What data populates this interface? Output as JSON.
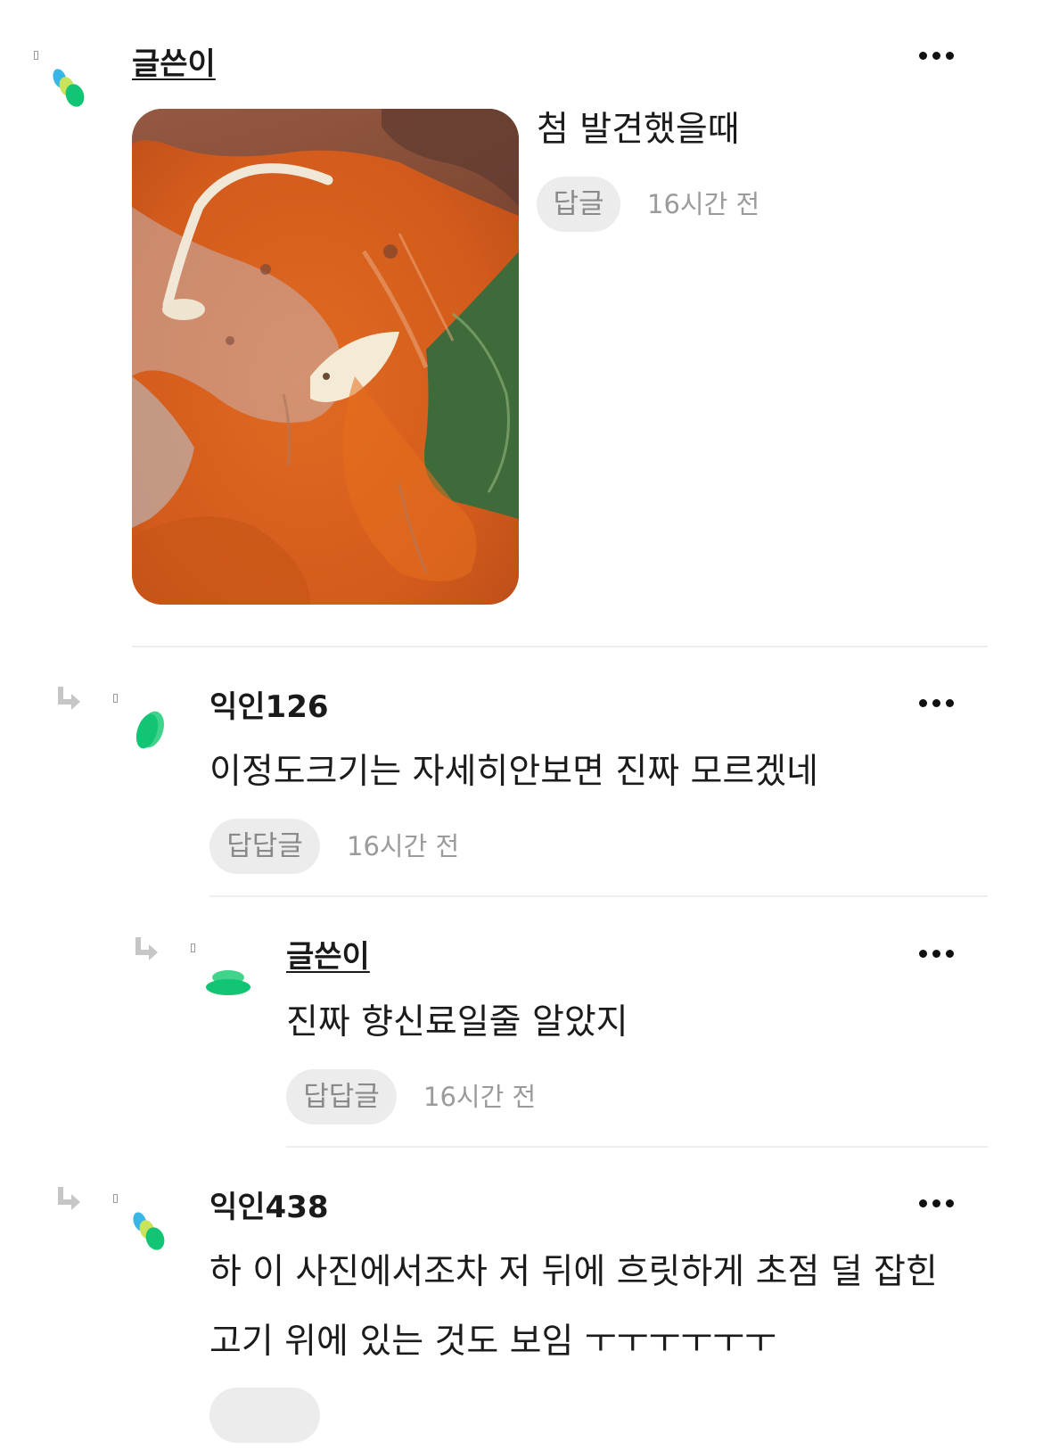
{
  "comments": [
    {
      "name": "글쓴이",
      "is_author": true,
      "text": "첨 발견했을때",
      "reply_label": "답글",
      "time": "16시간 전",
      "avatar": "leaf-cluster-multicolor"
    },
    {
      "name": "익인126",
      "is_author": false,
      "text": "이정도크기는 자세히안보면 진짜 모르겠네",
      "reply_label": "답답글",
      "time": "16시간 전",
      "avatar": "green-leaf"
    },
    {
      "name": "글쓴이",
      "is_author": true,
      "text": "진짜 향신료일줄 알았지",
      "reply_label": "답답글",
      "time": "16시간 전",
      "avatar": "green-stacked-ovals"
    },
    {
      "name": "익인438",
      "is_author": false,
      "text_lines": [
        "하 이 사진에서조차 저 뒤에 흐릿하게 초점 덜 잡힌",
        "고기 위에 있는 것도 보임 ㅜㅜㅜㅜㅜㅜ"
      ],
      "avatar": "leaf-cluster-multicolor"
    }
  ],
  "icons": {
    "more": "more-horizontal-icon",
    "reply_arrow": "reply-arrow-icon"
  },
  "colors": {
    "avatar_blue": "#38b6e6",
    "avatar_yellow": "#c9e35a",
    "avatar_green": "#12c574",
    "pill_bg": "#ececec",
    "muted_text": "#9b9b9b"
  }
}
